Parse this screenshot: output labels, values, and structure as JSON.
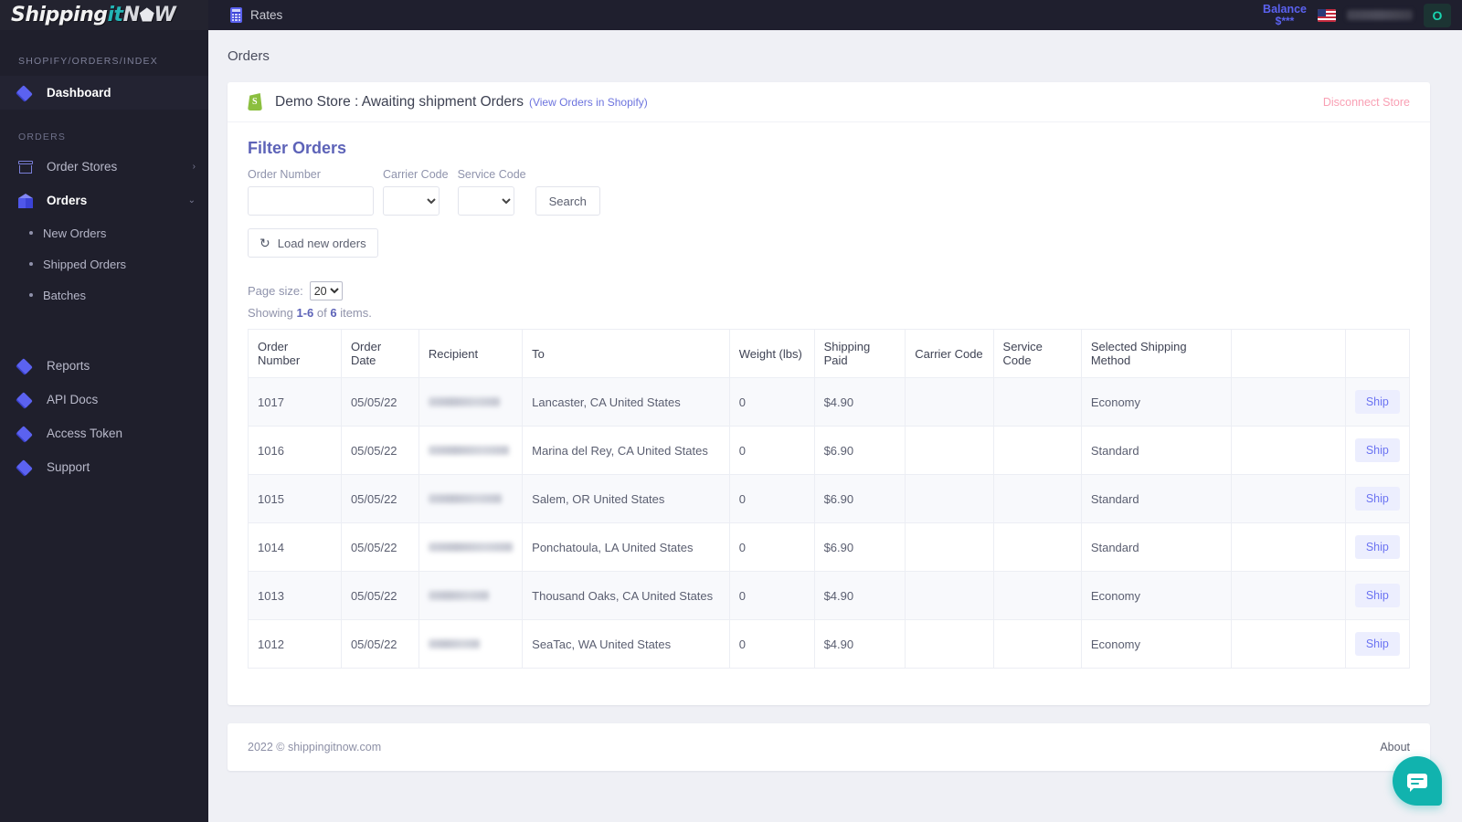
{
  "brand": {
    "logo_part1": "Shipping",
    "logo_it": "it",
    "logo_part2": "N",
    "logo_cube": "⬟",
    "logo_part3": "W"
  },
  "topbar": {
    "rates_label": "Rates",
    "balance_title": "Balance",
    "balance_value": "$***",
    "avatar_initial": "O"
  },
  "sidebar": {
    "breadcrumb": "SHOPIFY/ORDERS/INDEX",
    "dashboard_label": "Dashboard",
    "orders_section_label": "ORDERS",
    "order_stores_label": "Order Stores",
    "orders_label": "Orders",
    "chevron_right": "›",
    "chevron_down": "⌄",
    "sub_items": [
      {
        "label": "New Orders"
      },
      {
        "label": "Shipped Orders"
      },
      {
        "label": "Batches"
      }
    ],
    "bottom_items": [
      {
        "label": "Reports"
      },
      {
        "label": "API Docs"
      },
      {
        "label": "Access Token"
      },
      {
        "label": "Support"
      }
    ]
  },
  "page": {
    "title": "Orders"
  },
  "store_header": {
    "name": "Demo Store : Awaiting shipment Orders",
    "view_link": "(View Orders in Shopify)",
    "disconnect": "Disconnect Store"
  },
  "filter": {
    "title": "Filter Orders",
    "order_number_label": "Order Number",
    "order_number_value": "",
    "carrier_code_label": "Carrier Code",
    "carrier_code_value": "",
    "service_code_label": "Service Code",
    "service_code_value": "",
    "search_label": "Search",
    "load_label": "Load new orders",
    "refresh_icon": "↻"
  },
  "pager": {
    "page_size_label": "Page size:",
    "page_size_value": "20",
    "showing_prefix": "Showing ",
    "showing_range": "1-6",
    "showing_mid": " of ",
    "showing_total": "6",
    "showing_suffix": " items."
  },
  "table": {
    "columns": [
      "Order Number",
      "Order Date",
      "Recipient",
      "To",
      "Weight (lbs)",
      "Shipping Paid",
      "Carrier Code",
      "Service Code",
      "Selected Shipping Method",
      "",
      ""
    ],
    "ship_label": "Ship",
    "rows": [
      {
        "order_number": "1017",
        "order_date": "05/05/22",
        "recipient_redacted_width": 78,
        "to": "Lancaster, CA United States",
        "weight": "0",
        "shipping_paid": "$4.90",
        "carrier_code": "",
        "service_code": "",
        "method": "Economy"
      },
      {
        "order_number": "1016",
        "order_date": "05/05/22",
        "recipient_redacted_width": 88,
        "to": "Marina del Rey, CA United States",
        "weight": "0",
        "shipping_paid": "$6.90",
        "carrier_code": "",
        "service_code": "",
        "method": "Standard"
      },
      {
        "order_number": "1015",
        "order_date": "05/05/22",
        "recipient_redacted_width": 80,
        "to": "Salem, OR United States",
        "weight": "0",
        "shipping_paid": "$6.90",
        "carrier_code": "",
        "service_code": "",
        "method": "Standard"
      },
      {
        "order_number": "1014",
        "order_date": "05/05/22",
        "recipient_redacted_width": 92,
        "to": "Ponchatoula, LA United States",
        "weight": "0",
        "shipping_paid": "$6.90",
        "carrier_code": "",
        "service_code": "",
        "method": "Standard"
      },
      {
        "order_number": "1013",
        "order_date": "05/05/22",
        "recipient_redacted_width": 66,
        "to": "Thousand Oaks, CA United States",
        "weight": "0",
        "shipping_paid": "$4.90",
        "carrier_code": "",
        "service_code": "",
        "method": "Economy"
      },
      {
        "order_number": "1012",
        "order_date": "05/05/22",
        "recipient_redacted_width": 56,
        "to": "SeaTac, WA United States",
        "weight": "0",
        "shipping_paid": "$4.90",
        "carrier_code": "",
        "service_code": "",
        "method": "Economy"
      }
    ]
  },
  "footer": {
    "copyright": "2022 © shippingitnow.com",
    "about": "About"
  },
  "colors": {
    "sidebar_bg": "#1f1f2c",
    "topbar_bg": "#1f1f2e",
    "accent": "#5b62f0",
    "page_bg": "#eff0f5",
    "danger": "#f9a0b4",
    "chat": "#11b3ae",
    "shopify_green": "#8bbf3f"
  }
}
